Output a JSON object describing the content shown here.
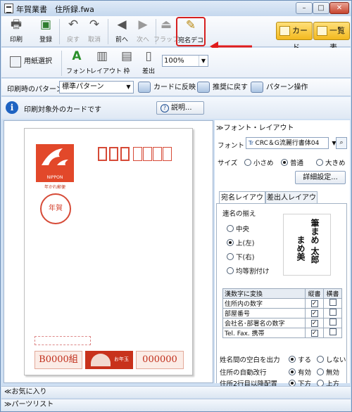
{
  "window": {
    "title": "年賀業書　住所録.fwa"
  },
  "toolbar": {
    "print": "印刷",
    "register": "登録",
    "undo": "戻す",
    "redo": "取消",
    "prev": "前へ",
    "next": "次へ",
    "flap": "フラップ",
    "atena_deco": "宛名デコ",
    "card": "カード",
    "list": "一覧表"
  },
  "toolbar2": {
    "paper_select": "用紙選択",
    "font": "フォント",
    "layout": "レイアウト",
    "frame": "枠",
    "sender": "差出",
    "zoom": "100%"
  },
  "toolbar3": {
    "print_pattern_label": "印刷時のパターン",
    "print_pattern_value": "標準パターン",
    "apply_to_card": "カードに反映",
    "reset_recommended": "推奨に戻す",
    "pattern_ops": "パターン操作"
  },
  "info": {
    "message": "印刷対象外のカードです",
    "explain": "説明..."
  },
  "card": {
    "stamp_brand": "NIPPON",
    "stamp_sub": "年かれ郵便",
    "nenga": "年賀",
    "kumi": "B0000組",
    "otoshi": "お年玉",
    "number": "000000"
  },
  "right_panel": {
    "header": "≫フォント・レイアウト",
    "font_label": "フォント",
    "font_value": "CRC＆G流麗行書体04",
    "size_label": "サイズ",
    "size_options": [
      "小さめ",
      "普通",
      "大きめ"
    ],
    "size_selected": "普通",
    "detail": "詳細設定...",
    "tabs": [
      "宛名レイアウト",
      "差出人レイアウト"
    ],
    "renmei_label": "連名の揃え",
    "renmei_options": [
      "中央",
      "上(左)",
      "下(右)",
      "均等割付け"
    ],
    "renmei_selected": "上(左)",
    "sample_name": "筆まめ 太郎",
    "sample_name2": "まめ美",
    "table_head": [
      "漢数字に変換",
      "縦書",
      "横書"
    ],
    "table_rows": [
      {
        "label": "住所内の数字",
        "tate": true,
        "yoko": false
      },
      {
        "label": "部屋番号",
        "tate": true,
        "yoko": false
      },
      {
        "label": "会社名･部署名の数字",
        "tate": true,
        "yoko": false
      },
      {
        "label": "Tel. Fax. 携帯",
        "tate": true,
        "yoko": false
      }
    ],
    "space_label": "姓名間の空白を出力",
    "space_options": [
      "する",
      "しない"
    ],
    "autobreak_label": "住所の自動改行",
    "autobreak_options": [
      "有効",
      "無効"
    ],
    "line2_label": "住所2行目以降配置",
    "line2_options": [
      "下方",
      "上方"
    ]
  },
  "bottom": {
    "favorites": "≪お気に入り",
    "parts": "≫パーツリスト"
  }
}
